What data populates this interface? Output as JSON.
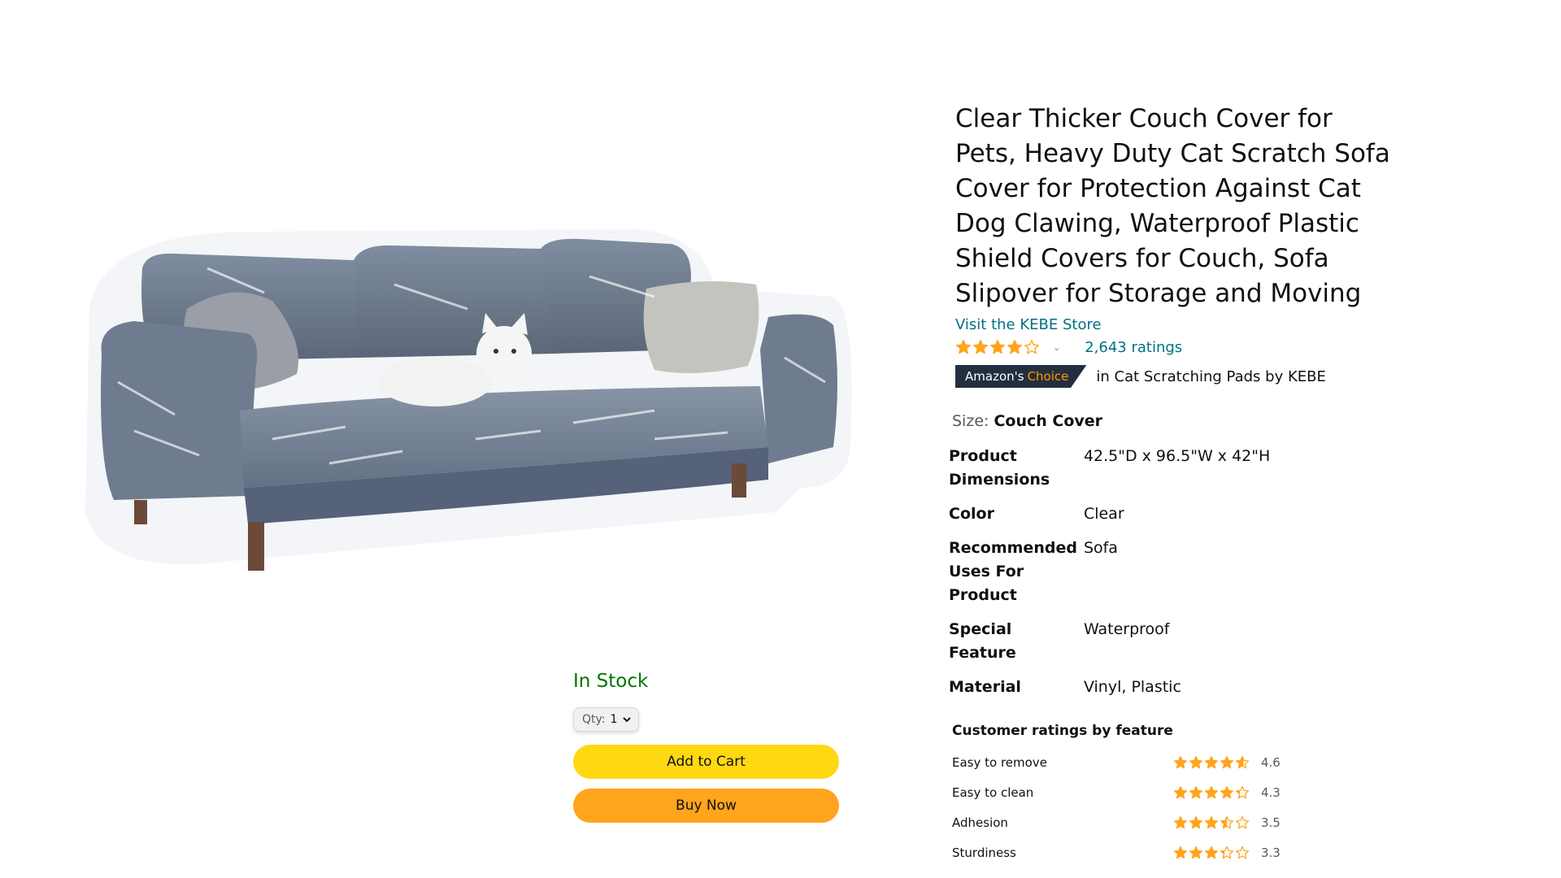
{
  "product": {
    "title": "Clear Thicker Couch Cover for Pets, Heavy Duty Cat Scratch Sofa Cover for Protection Against Cat Dog Clawing, Waterproof Plastic Shield Covers for Couch, Sofa Slipover for Storage and Moving",
    "store_link": "Visit the KEBE Store",
    "rating": 3.9,
    "ratings_count": "2,643 ratings",
    "badge_prefix": "Amazon's",
    "badge_choice": "Choice",
    "badge_context": "in Cat Scratching Pads by KEBE",
    "image_icon": "couch-with-cat-photo"
  },
  "size": {
    "label": "Size:",
    "value": "Couch Cover"
  },
  "specs": [
    {
      "key": "Product Dimensions",
      "value": "42.5\"D x 96.5\"W x 42\"H"
    },
    {
      "key": "Color",
      "value": "Clear"
    },
    {
      "key": "Recommended Uses For Product",
      "value": "Sofa"
    },
    {
      "key": "Special Feature",
      "value": "Waterproof"
    },
    {
      "key": "Material",
      "value": "Vinyl, Plastic"
    }
  ],
  "feature_ratings": {
    "title": "Customer ratings by feature",
    "items": [
      {
        "name": "Easy to remove",
        "score": "4.6",
        "stars": 4.6
      },
      {
        "name": "Easy to clean",
        "score": "4.3",
        "stars": 4.3
      },
      {
        "name": "Adhesion",
        "score": "3.5",
        "stars": 3.5
      },
      {
        "name": "Sturdiness",
        "score": "3.3",
        "stars": 3.3
      }
    ]
  },
  "buybox": {
    "stock": "In Stock",
    "qty_label": "Qty:",
    "qty_value": "1",
    "add_to_cart": "Add to Cart",
    "buy_now": "Buy Now"
  },
  "colors": {
    "star": "#FFA41C",
    "link": "#007185",
    "in_stock": "#007600",
    "cart_button": "#FFD814",
    "buy_button": "#FFA41C",
    "badge_bg": "#232F3E",
    "badge_accent": "#FF9900"
  }
}
